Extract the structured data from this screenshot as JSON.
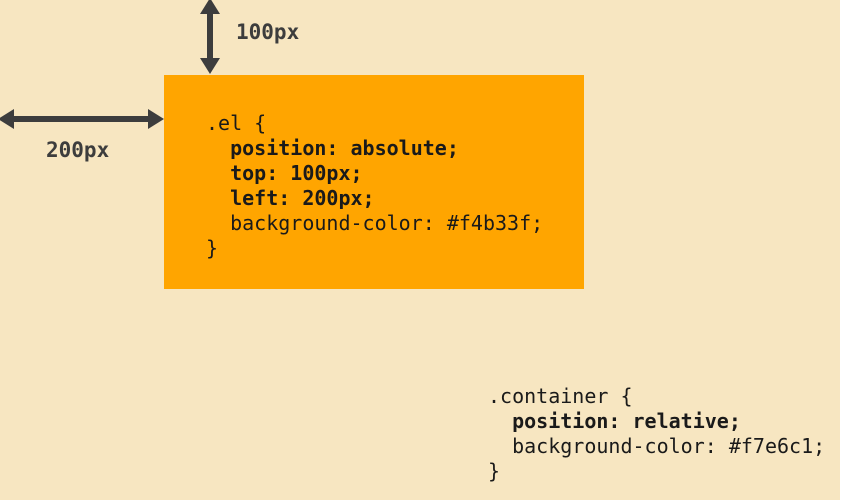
{
  "labels": {
    "top_offset": "100px",
    "left_offset": "200px"
  },
  "el_block": {
    "line1": ".el {",
    "line2": "  position: absolute;",
    "line3": "  top: 100px;",
    "line4": "  left: 200px;",
    "line5": "  background-color: #f4b33f;",
    "line6": "}"
  },
  "container_block": {
    "line1": ".container {",
    "line2": "  position: relative;",
    "line3": "  background-color: #f7e6c1;",
    "line4": "}"
  },
  "colors": {
    "container_background": "#f7e6c1",
    "element_background": "#ffa500",
    "arrow": "#3d3d3d"
  }
}
